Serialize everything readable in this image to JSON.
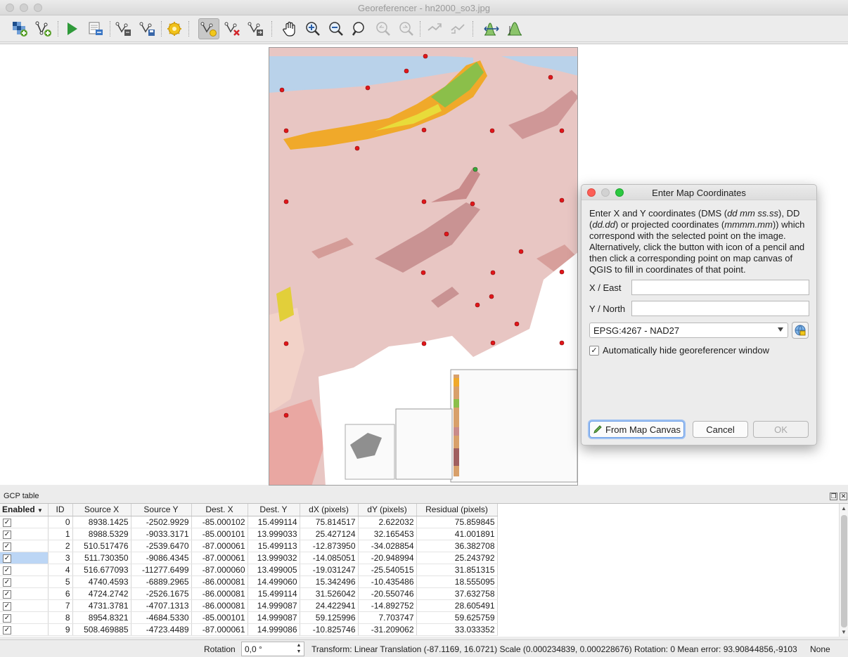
{
  "window": {
    "title": "Georeferencer - hn2000_so3.jpg"
  },
  "toolbar": {
    "items": [
      "open-raster-icon",
      "add-point-icon",
      "start-georeferencing-icon",
      "generate-gdal-script-icon",
      "load-gcp-points-icon",
      "save-gcp-points-icon",
      "transformation-settings-icon",
      "add-point-tool-icon",
      "delete-point-icon",
      "move-gcp-point-icon",
      "pan-icon",
      "zoom-in-icon",
      "zoom-out-icon",
      "zoom-to-layer-icon",
      "zoom-last-icon",
      "zoom-next-icon",
      "link-georeferencer-icon",
      "link-qgis-icon",
      "full-histogram-stretch-icon",
      "local-histogram-stretch-icon"
    ]
  },
  "dialog": {
    "title": "Enter Map Coordinates",
    "description_parts": [
      "Enter X and Y coordinates (DMS (",
      "dd mm ss.ss",
      "), DD (",
      "dd.dd",
      ") or projected coordinates (",
      "mmmm.mm",
      ")) which correspond with the selected point on the image. Alternatively, click the button with icon of a pencil and then click a corresponding point on map canvas of QGIS to fill in coordinates of that point."
    ],
    "x_label": "X / East",
    "x_value": "",
    "y_label": "Y / North",
    "y_value": "",
    "crs": "EPSG:4267 - NAD27",
    "auto_hide_checked": true,
    "auto_hide_label": "Automatically hide georeferencer window",
    "from_map_canvas": "From Map Canvas",
    "cancel": "Cancel",
    "ok": "OK"
  },
  "gcp": {
    "title": "GCP table",
    "columns": [
      "Enabled",
      "ID",
      "Source X",
      "Source Y",
      "Dest. X",
      "Dest. Y",
      "dX (pixels)",
      "dY (pixels)",
      "Residual (pixels)"
    ],
    "rows": [
      {
        "enabled": true,
        "id": "0",
        "sx": "8938.1425",
        "sy": "-2502.9929",
        "dx": "-85.000102",
        "dy": "15.499114",
        "px": "75.814517",
        "py": "2.622032",
        "res": "75.859845"
      },
      {
        "enabled": true,
        "id": "1",
        "sx": "8988.5329",
        "sy": "-9033.3171",
        "dx": "-85.000101",
        "dy": "13.999033",
        "px": "25.427124",
        "py": "32.165453",
        "res": "41.001891"
      },
      {
        "enabled": true,
        "id": "2",
        "sx": "510.517476",
        "sy": "-2539.6470",
        "dx": "-87.000061",
        "dy": "15.499113",
        "px": "-12.873950",
        "py": "-34.028854",
        "res": "36.382708"
      },
      {
        "enabled": true,
        "id": "3",
        "sx": "511.730350",
        "sy": "-9086.4345",
        "dx": "-87.000061",
        "dy": "13.999032",
        "px": "-14.085051",
        "py": "-20.948994",
        "res": "25.243792"
      },
      {
        "enabled": true,
        "id": "4",
        "sx": "516.677093",
        "sy": "-11277.6499",
        "dx": "-87.000060",
        "dy": "13.499005",
        "px": "-19.031247",
        "py": "-25.540515",
        "res": "31.851315"
      },
      {
        "enabled": true,
        "id": "5",
        "sx": "4740.4593",
        "sy": "-6889.2965",
        "dx": "-86.000081",
        "dy": "14.499060",
        "px": "15.342496",
        "py": "-10.435486",
        "res": "18.555095"
      },
      {
        "enabled": true,
        "id": "6",
        "sx": "4724.2742",
        "sy": "-2526.1675",
        "dx": "-86.000081",
        "dy": "15.499114",
        "px": "31.526042",
        "py": "-20.550746",
        "res": "37.632758"
      },
      {
        "enabled": true,
        "id": "7",
        "sx": "4731.3781",
        "sy": "-4707.1313",
        "dx": "-86.000081",
        "dy": "14.999087",
        "px": "24.422941",
        "py": "-14.892752",
        "res": "28.605491"
      },
      {
        "enabled": true,
        "id": "8",
        "sx": "8954.8321",
        "sy": "-4684.5330",
        "dx": "-85.000101",
        "dy": "14.999087",
        "px": "59.125996",
        "py": "7.703747",
        "res": "59.625759"
      },
      {
        "enabled": true,
        "id": "9",
        "sx": "508.469885",
        "sy": "-4723.4489",
        "dx": "-87.000061",
        "dy": "14.999086",
        "px": "-10.825746",
        "py": "-31.209062",
        "res": "33.033352"
      }
    ],
    "selected_row": 3
  },
  "status": {
    "rotation_label": "Rotation",
    "rotation_value": "0,0 °",
    "transform": "Transform: Linear Translation (-87.1169, 16.0721) Scale (0.000234839, 0.000228676) Rotation: 0 Mean error: 93.9084",
    "coords": "-4856,-9103",
    "crs": "None"
  }
}
